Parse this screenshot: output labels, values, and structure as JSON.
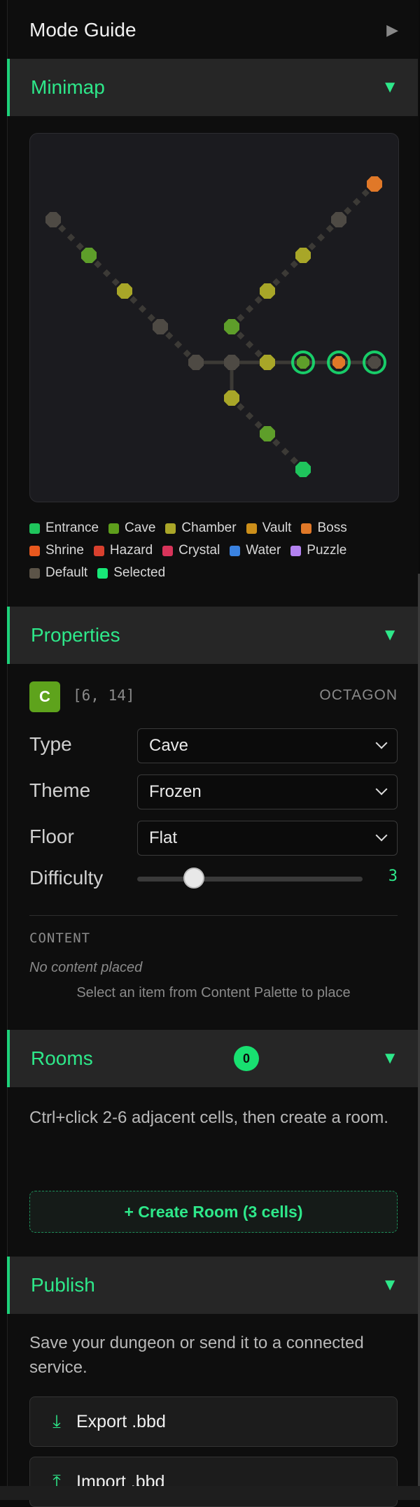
{
  "mode_guide": {
    "title": "Mode Guide",
    "arrow": "▶"
  },
  "minimap": {
    "title": "Minimap",
    "arrow": "▼",
    "colors": {
      "default": "#4e4a44",
      "entrance": "#1fc45c",
      "cave": "#5e9e2a",
      "chamber": "#a8a628",
      "boss": "#e07828",
      "selected_ring": "#18e070",
      "connector": "#3c3a36"
    },
    "legend": [
      {
        "label": "Entrance",
        "color": "#1fc45c"
      },
      {
        "label": "Cave",
        "color": "#5e9e1c"
      },
      {
        "label": "Chamber",
        "color": "#aaa628"
      },
      {
        "label": "Vault",
        "color": "#cc8f1a"
      },
      {
        "label": "Boss",
        "color": "#e07828"
      },
      {
        "label": "Shrine",
        "color": "#e8581e"
      },
      {
        "label": "Hazard",
        "color": "#d8402e"
      },
      {
        "label": "Crystal",
        "color": "#d8345a"
      },
      {
        "label": "Water",
        "color": "#3a82e0"
      },
      {
        "label": "Puzzle",
        "color": "#b482f0"
      },
      {
        "label": "Default",
        "color": "#5c5448"
      },
      {
        "label": "Selected",
        "color": "#18e878"
      }
    ]
  },
  "properties": {
    "title": "Properties",
    "arrow": "▼",
    "cell_badge": "C",
    "coords": "[6, 14]",
    "shape": "OCTAGON",
    "type_label": "Type",
    "type_value": "Cave",
    "theme_label": "Theme",
    "theme_value": "Frozen",
    "floor_label": "Floor",
    "floor_value": "Flat",
    "difficulty_label": "Difficulty",
    "difficulty_value": "3",
    "difficulty_level": 0.25,
    "content_label": "CONTENT",
    "content_empty": "No content placed",
    "content_hint": "Select an item from Content Palette to place"
  },
  "rooms": {
    "title": "Rooms",
    "count": "0",
    "arrow": "▼",
    "instructions": "Ctrl+click 2-6 adjacent cells, then create a room.",
    "create_button": "+ Create Room (3 cells)"
  },
  "publish": {
    "title": "Publish",
    "arrow": "▼",
    "description": "Save your dungeon or send it to a connected service.",
    "export_button": "Export .bbd",
    "export_icon": "⤓",
    "import_button": "Import .bbd",
    "import_icon": "⤒"
  }
}
